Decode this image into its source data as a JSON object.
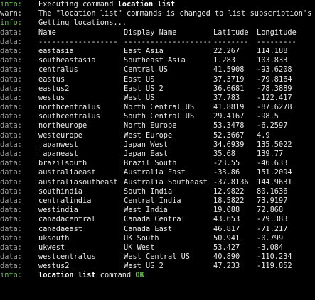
{
  "colors": {
    "info": "#5ec83a",
    "warn": "#d7d7d7",
    "data": "#9a9a9a",
    "ok": "#5ec83a"
  },
  "prefixes": {
    "info": "info:",
    "warn": "warn:",
    "data": "data:"
  },
  "header": {
    "executing_text": "Executing command ",
    "executing_cmd": "location list",
    "warn_text": "The \"location list\" commands is changed to list subscription's lo",
    "getting": "Getting locations..."
  },
  "table": {
    "columns": [
      "Name",
      "Display Name",
      "Latitude",
      "Longitude"
    ],
    "separators": [
      "------------------",
      "--------------------",
      "--------",
      "---------"
    ],
    "rows": [
      [
        "eastasia",
        "East Asia",
        "22.267",
        "114.188"
      ],
      [
        "southeastasia",
        "Southeast Asia",
        "1.283",
        "103.833"
      ],
      [
        "centralus",
        "Central US",
        "41.5908",
        "-93.6208"
      ],
      [
        "eastus",
        "East US",
        "37.3719",
        "-79.8164"
      ],
      [
        "eastus2",
        "East US 2",
        "36.6681",
        "-78.3889"
      ],
      [
        "westus",
        "West US",
        "37.783",
        "-122.417"
      ],
      [
        "northcentralus",
        "North Central US",
        "41.8819",
        "-87.6278"
      ],
      [
        "southcentralus",
        "South Central US",
        "29.4167",
        "-98.5"
      ],
      [
        "northeurope",
        "North Europe",
        "53.3478",
        "-6.2597"
      ],
      [
        "westeurope",
        "West Europe",
        "52.3667",
        "4.9"
      ],
      [
        "japanwest",
        "Japan West",
        "34.6939",
        "135.5022"
      ],
      [
        "japaneast",
        "Japan East",
        "35.68",
        "139.77"
      ],
      [
        "brazilsouth",
        "Brazil South",
        "-23.55",
        "-46.633"
      ],
      [
        "australiaeast",
        "Australia East",
        "-33.86",
        "151.2094"
      ],
      [
        "australiasoutheast",
        "Australia Southeast",
        "-37.8136",
        "144.9631"
      ],
      [
        "southindia",
        "South India",
        "12.9822",
        "80.1636"
      ],
      [
        "centralindia",
        "Central India",
        "18.5822",
        "73.9197"
      ],
      [
        "westindia",
        "West India",
        "19.088",
        "72.868"
      ],
      [
        "canadacentral",
        "Canada Central",
        "43.653",
        "-79.383"
      ],
      [
        "canadaeast",
        "Canada East",
        "46.817",
        "-71.217"
      ],
      [
        "uksouth",
        "UK South",
        "50.941",
        "-0.799"
      ],
      [
        "ukwest",
        "UK West",
        "53.427",
        "-3.084"
      ],
      [
        "westcentralus",
        "West Central US",
        "40.890",
        "-110.234"
      ],
      [
        "westus2",
        "West US 2",
        "47.233",
        "-119.852"
      ]
    ]
  },
  "footer": {
    "cmd": "location list",
    "word": " command ",
    "ok": "OK"
  }
}
